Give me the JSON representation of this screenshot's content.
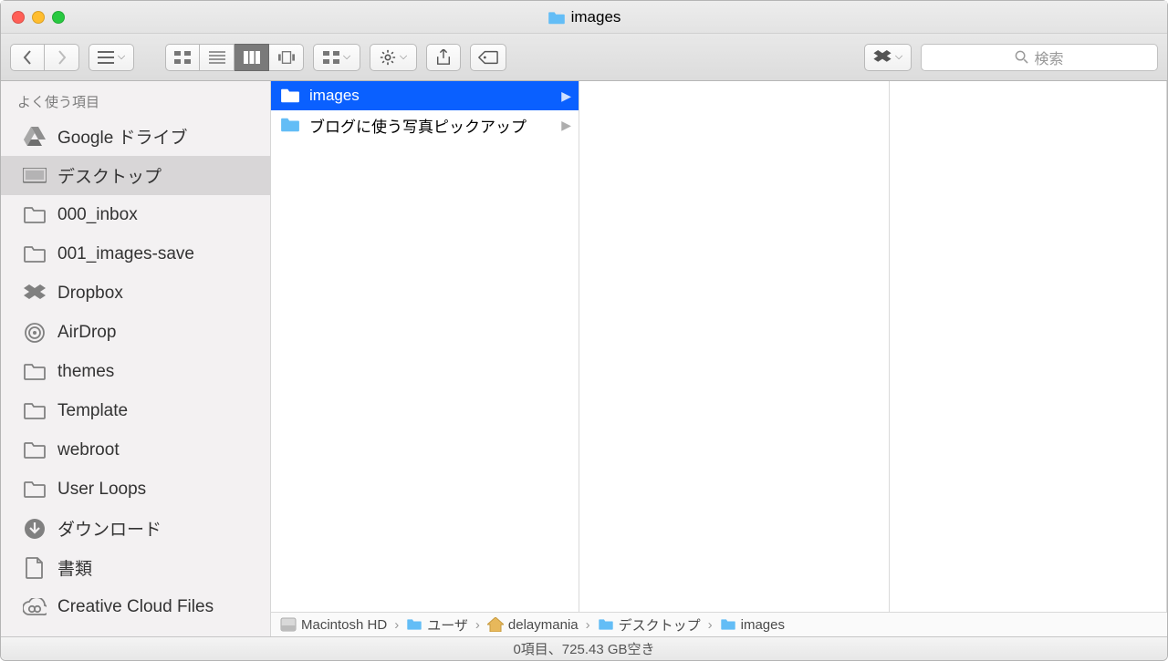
{
  "window": {
    "title": "images"
  },
  "toolbar": {
    "search_placeholder": "検索"
  },
  "sidebar": {
    "heading": "よく使う項目",
    "items": [
      {
        "label": "Google ドライブ",
        "icon": "gdrive"
      },
      {
        "label": "デスクトップ",
        "icon": "desktop",
        "selected": true
      },
      {
        "label": "000_inbox",
        "icon": "folder"
      },
      {
        "label": "001_images-save",
        "icon": "folder"
      },
      {
        "label": "Dropbox",
        "icon": "dropbox"
      },
      {
        "label": "AirDrop",
        "icon": "airdrop"
      },
      {
        "label": "themes",
        "icon": "folder"
      },
      {
        "label": "Template",
        "icon": "folder"
      },
      {
        "label": "webroot",
        "icon": "folder"
      },
      {
        "label": "User Loops",
        "icon": "folder"
      },
      {
        "label": "ダウンロード",
        "icon": "download"
      },
      {
        "label": "書類",
        "icon": "document"
      },
      {
        "label": "Creative Cloud Files",
        "icon": "cc"
      }
    ]
  },
  "columns": [
    [
      {
        "label": "images",
        "selected": true,
        "has_children": true
      },
      {
        "label": "ブログに使う写真ピックアップ",
        "has_children": true
      }
    ]
  ],
  "pathbar": {
    "crumbs": [
      {
        "label": "Macintosh HD",
        "icon": "disk"
      },
      {
        "label": "ユーザ",
        "icon": "folder-blue"
      },
      {
        "label": "delaymania",
        "icon": "home"
      },
      {
        "label": "デスクトップ",
        "icon": "folder-blue"
      },
      {
        "label": "images",
        "icon": "folder-blue"
      }
    ]
  },
  "statusbar": {
    "text": "0項目、725.43 GB空き"
  }
}
